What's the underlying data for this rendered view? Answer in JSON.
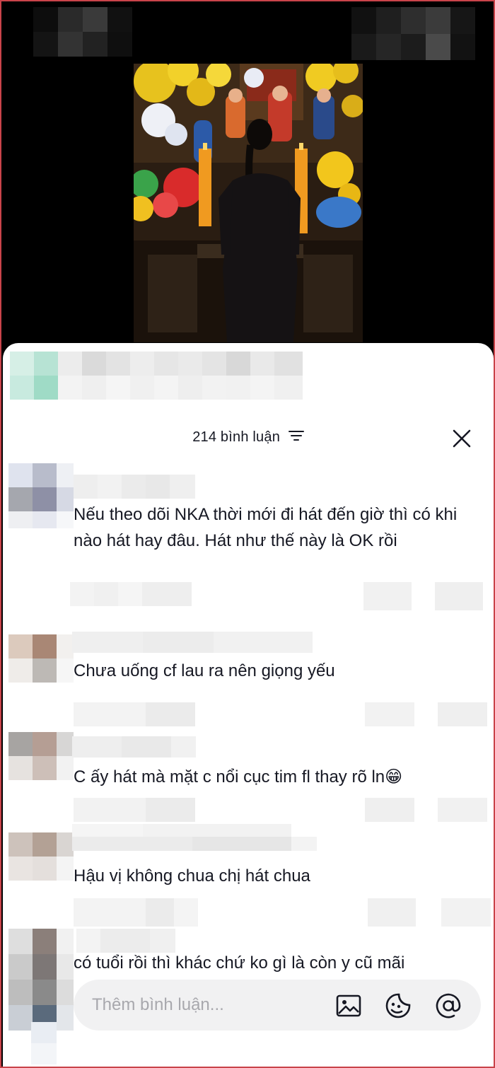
{
  "sheet": {
    "comment_count_label": "214 bình luận",
    "icons": {
      "filter": "filter-lines-icon",
      "close": "close-x-icon"
    }
  },
  "comments": [
    {
      "text": "Nếu theo dõi NKA thời mới đi hát đến giờ thì có khi nào hát hay đâu. Hát như thế này là OK rồi"
    },
    {
      "text": "Chưa uống cf lau ra nên giọng yếu"
    },
    {
      "text": "C ấy hát mà mặt c nổi cục tim fl thay rõ ln",
      "emoji": "😁"
    },
    {
      "text": "Hậu vị không chua chị hát chua"
    },
    {
      "text": "có tuổi rồi thì khác chứ ko gì là còn y cũ mãi"
    }
  ],
  "composer": {
    "placeholder": "Thêm bình luận...",
    "icons": {
      "image": "image-icon",
      "sticker": "sticker-icon",
      "mention": "mention-at-icon"
    }
  },
  "colors": {
    "frame_border": "#c9434a",
    "text": "#161823",
    "muted": "#a8a8ad",
    "compose_bg": "#f1f1f2"
  }
}
